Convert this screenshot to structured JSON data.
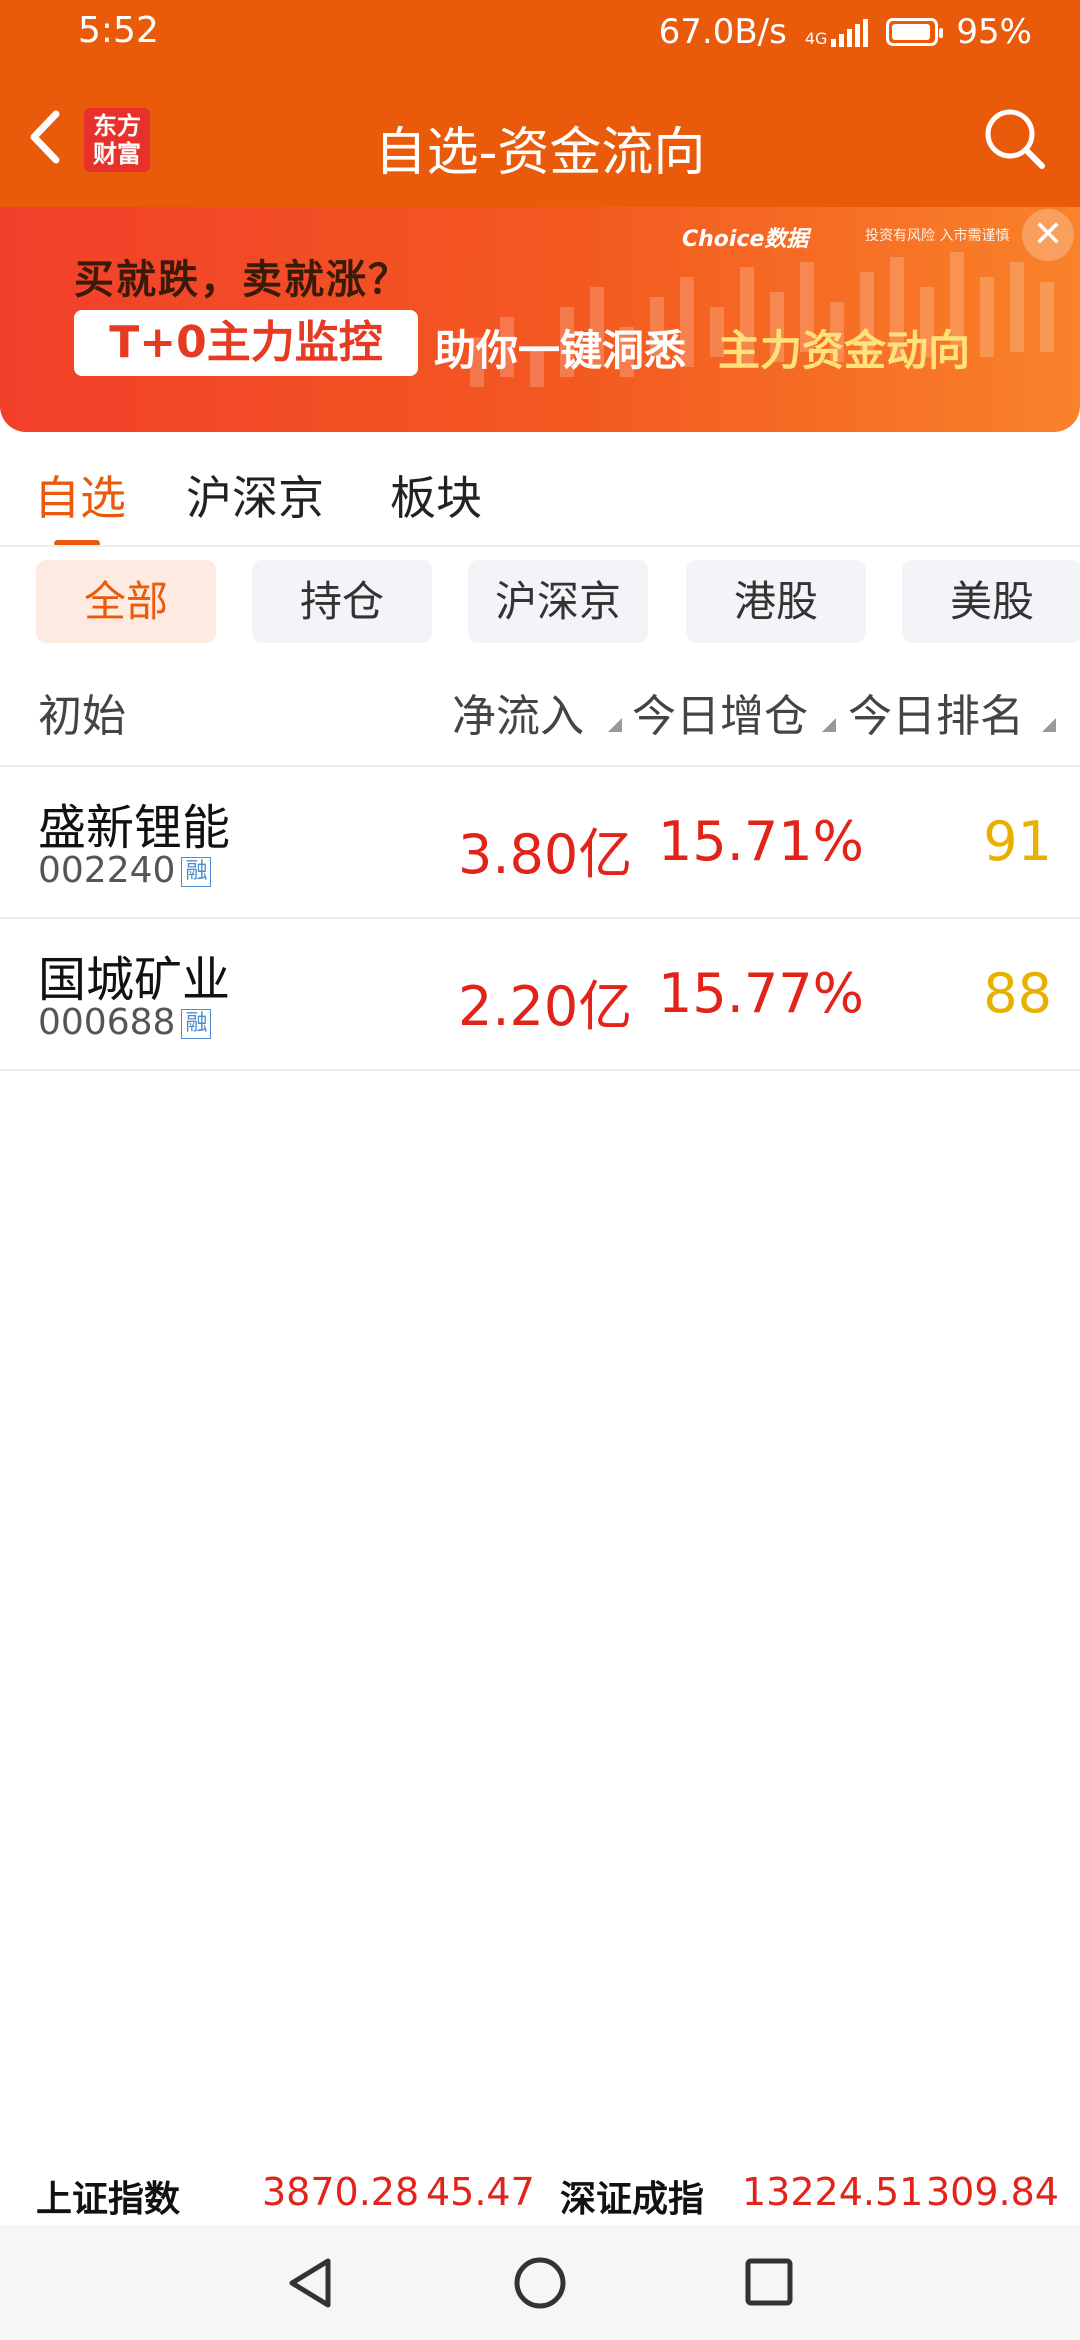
{
  "status_bar": {
    "time": "5:52",
    "net_speed": "67.0B/s",
    "signal": "4G",
    "battery": "95%",
    "battery_level": 0.95
  },
  "header": {
    "logo_text": "东方财富",
    "title": "自选-资金流向"
  },
  "banner": {
    "line1": "买就跌，卖就涨？",
    "pill": "T+0主力监控",
    "line2_white": "助你一键洞悉",
    "line2_yellow": "主力资金动向",
    "choice": "Choice数据",
    "risk": "投资有风险 入市需谨慎",
    "close": "✕"
  },
  "tabs": [
    {
      "label": "自选",
      "active": true
    },
    {
      "label": "沪深京",
      "active": false
    },
    {
      "label": "板块",
      "active": false
    }
  ],
  "chips": [
    {
      "label": "全部",
      "active": true
    },
    {
      "label": "持仓",
      "active": false
    },
    {
      "label": "沪深京",
      "active": false
    },
    {
      "label": "港股",
      "active": false
    },
    {
      "label": "美股",
      "active": false
    }
  ],
  "columns": {
    "name": "初始",
    "net_inflow": "净流入",
    "today_increase": "今日增仓",
    "today_rank": "今日排名"
  },
  "rows": [
    {
      "name": "盛新锂能",
      "code": "002240",
      "badge": "融",
      "net_inflow": "3.80亿",
      "increase": "15.71%",
      "rank": "91"
    },
    {
      "name": "国城矿业",
      "code": "000688",
      "badge": "融",
      "net_inflow": "2.20亿",
      "increase": "15.77%",
      "rank": "88"
    }
  ],
  "ticker": {
    "sh_label": "上证指数",
    "sh_value": "3870.28",
    "sh_change": "45.47",
    "sz_label": "深证成指",
    "sz_value": "13224.51",
    "sz_change": "309.84"
  },
  "colors": {
    "brand": "#EA5A0B",
    "up_red": "#E2231A",
    "rank_yellow": "#E8B100"
  }
}
